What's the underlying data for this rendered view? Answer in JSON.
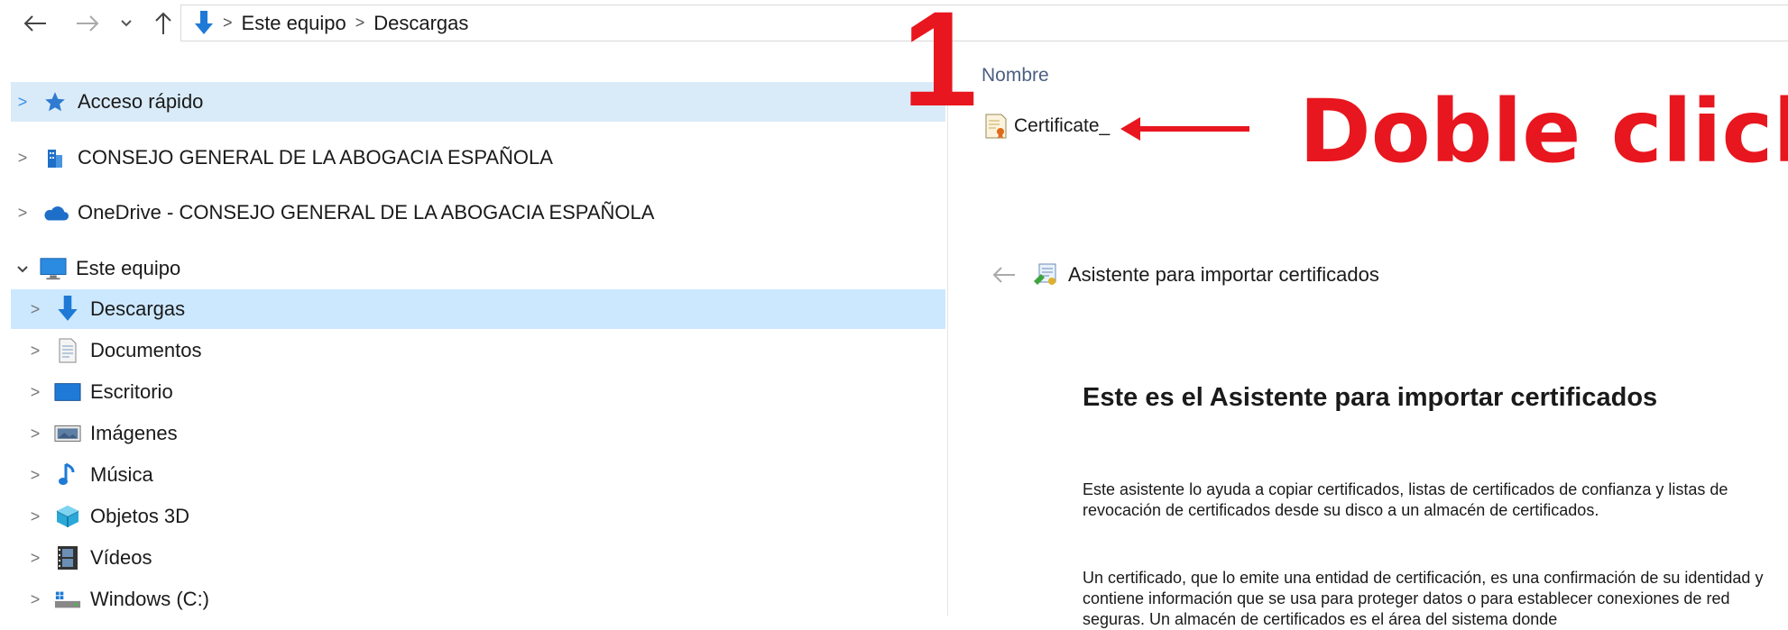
{
  "address_bar": {
    "breadcrumbs": [
      "Este equipo",
      "Descargas"
    ]
  },
  "nav": {
    "quick_access": "Acceso rápido",
    "org": "CONSEJO GENERAL DE LA ABOGACIA ESPAÑOLA",
    "onedrive": "OneDrive - CONSEJO GENERAL DE LA ABOGACIA ESPAÑOLA",
    "this_pc": "Este equipo",
    "items": [
      "Descargas",
      "Documentos",
      "Escritorio",
      "Imágenes",
      "Música",
      "Objetos 3D",
      "Vídeos",
      "Windows  (C:)"
    ]
  },
  "file_list": {
    "column_header": "Nombre",
    "files": [
      "Certificate_"
    ]
  },
  "annotation": {
    "step_number": "1",
    "instruction": "Doble click",
    "color": "#e8161e"
  },
  "wizard": {
    "header": "Asistente para importar certificados",
    "title": "Este es el Asistente para importar certificados",
    "paragraph1": "Este asistente lo ayuda a copiar certificados, listas de certificados de confianza y listas de revocación de certificados desde su disco a un almacén de certificados.",
    "paragraph2": "Un certificado, que lo emite una entidad de certificación, es una confirmación de su identidad y contiene información que se usa para proteger datos o para establecer conexiones de red seguras. Un almacén de certificados es el área del sistema donde"
  },
  "icons": {
    "back": "back-arrow-icon",
    "forward": "forward-arrow-icon",
    "recent": "chevron-down-icon",
    "up": "up-arrow-icon",
    "downloads": "download-arrow-icon",
    "star": "star-icon",
    "building": "building-icon",
    "cloud": "cloud-icon",
    "monitor": "monitor-icon",
    "certificate": "certificate-icon"
  }
}
